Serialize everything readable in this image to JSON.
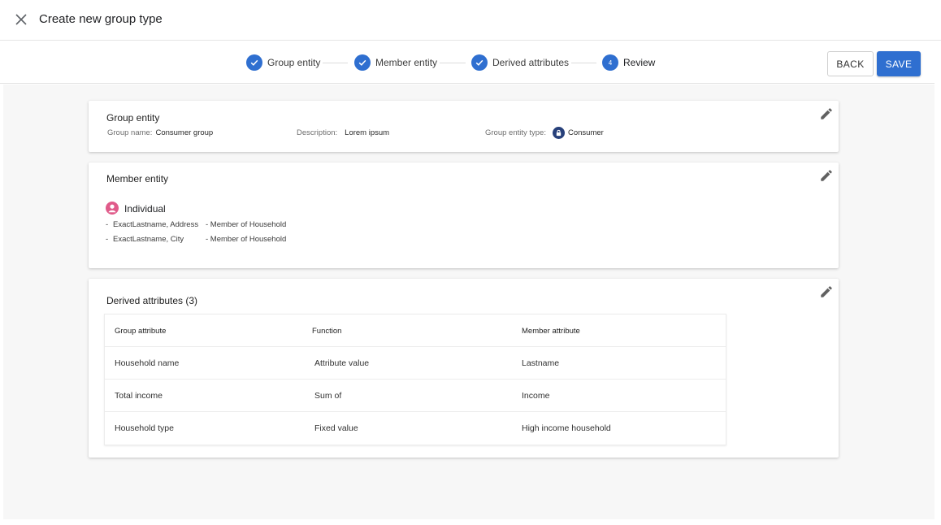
{
  "header": {
    "title": "Create new group type"
  },
  "stepper": {
    "steps": [
      {
        "label": "Group entity",
        "state": "done"
      },
      {
        "label": "Member entity",
        "state": "done"
      },
      {
        "label": "Derived attributes",
        "state": "done"
      },
      {
        "label": "Review",
        "state": "active",
        "number": "4"
      }
    ],
    "back_label": "BACK",
    "save_label": "SAVE"
  },
  "group_entity": {
    "title": "Group entity",
    "name_label": "Group name:",
    "name_value": "Consumer group",
    "description_label": "Description:",
    "description_value": "Lorem ipsum",
    "type_label": "Group entity type:",
    "type_value": "Consumer"
  },
  "member_entity": {
    "title": "Member entity",
    "entity_label": "Individual",
    "rules": [
      {
        "dash": "-",
        "left": "ExactLastname, Address",
        "right": "- Member of Household"
      },
      {
        "dash": "-",
        "left": "ExactLastname, City",
        "right": "- Member of Household"
      }
    ]
  },
  "derived_attributes": {
    "title": "Derived attributes (3)",
    "columns": [
      "Group attribute",
      "Function",
      "Member attribute"
    ],
    "rows": [
      [
        "Household name",
        "Attribute value",
        "Lastname"
      ],
      [
        "Total income",
        "Sum of",
        "Income"
      ],
      [
        "Household type",
        "Fixed value",
        "High income household"
      ]
    ]
  },
  "colors": {
    "accent": "#2f6fd0",
    "badge": "#27407a",
    "individual": "#e05b8a"
  },
  "icons": {
    "close": "close-icon",
    "check": "check-icon",
    "edit": "pencil-icon",
    "person": "person-icon",
    "lock": "lock-icon"
  }
}
